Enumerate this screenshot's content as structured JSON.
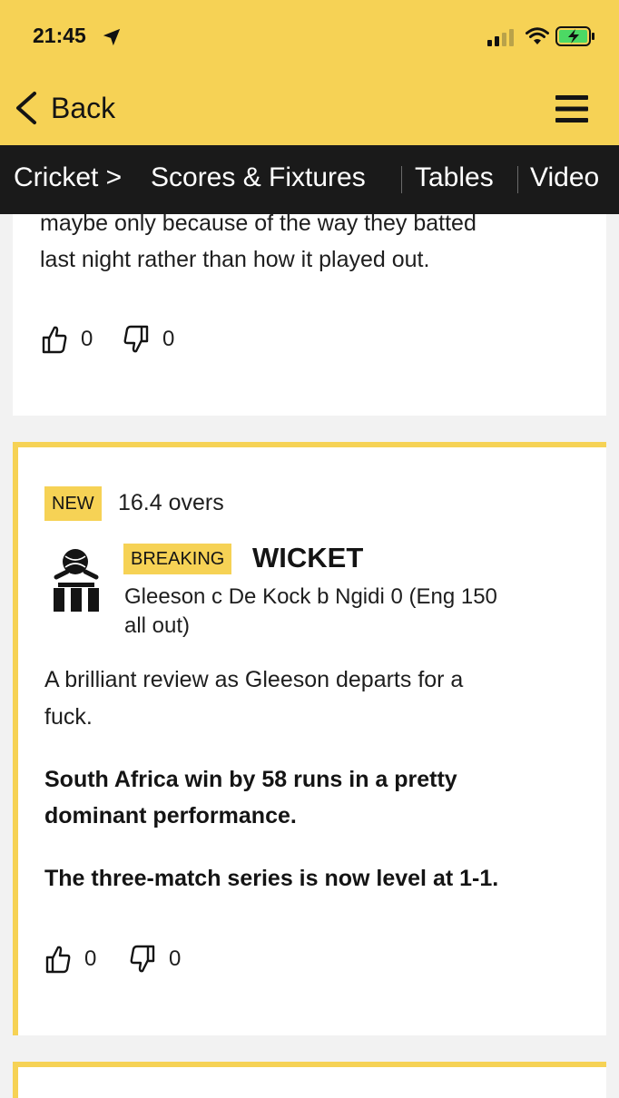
{
  "status_bar": {
    "time": "21:45",
    "icons": [
      "location-arrow-icon",
      "cellular-signal-icon",
      "wifi-icon",
      "battery-charging-icon"
    ],
    "battery_color": "#4cd964"
  },
  "header": {
    "back_label": "Back",
    "menu_icon": "hamburger-menu-icon",
    "background": "#f6d255"
  },
  "nav": {
    "section": "Cricket >",
    "items": [
      "Scores & Fixtures",
      "Tables",
      "Video"
    ]
  },
  "feed": {
    "previous_post": {
      "text_line1": "maybe only because of the way they batted",
      "text_line2": "last night rather than how it played out.",
      "likes": "0",
      "dislikes": "0"
    },
    "latest_post": {
      "new_badge": "NEW",
      "overs": "16.4 overs",
      "breaking_badge": "BREAKING",
      "event_title": "WICKET",
      "event_line1": "Gleeson c De Kock b Ngidi 0 (Eng 150",
      "event_line2": "all out)",
      "para1_line1": "A brilliant review as Gleeson departs for a",
      "para1_line2": "fuck.",
      "bold1_line1": "South Africa win by 58 runs in a pretty",
      "bold1_line2": "dominant performance.",
      "bold2": "The three-match series is now level at 1-1.",
      "likes": "0",
      "dislikes": "0"
    }
  }
}
